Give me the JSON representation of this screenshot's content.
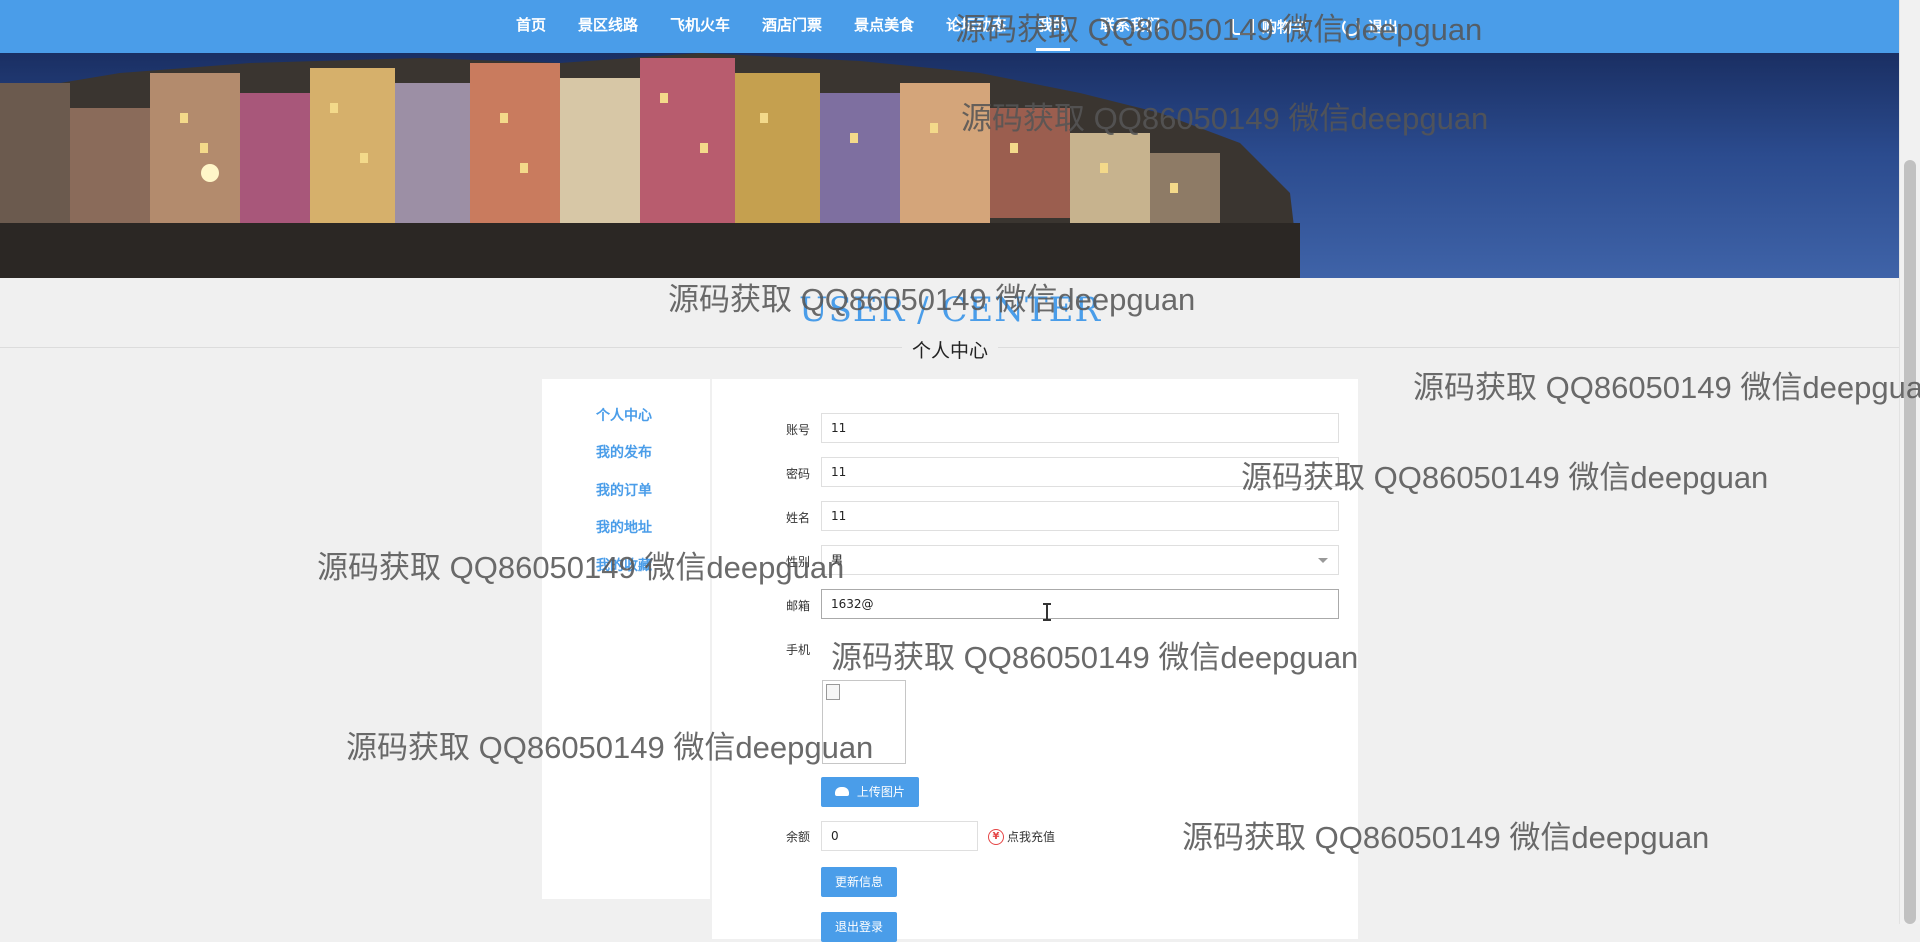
{
  "nav": {
    "items": [
      "首页",
      "景区线路",
      "飞机火车",
      "酒店门票",
      "景点美食",
      "论坛动态",
      "我的",
      "联系我们"
    ],
    "active_index": 6,
    "cart_label": "购物车",
    "logout_label": "退出"
  },
  "heading": {
    "en": "USER / CENTER",
    "cn": "个人中心"
  },
  "side_menu": [
    "个人中心",
    "我的发布",
    "我的订单",
    "我的地址",
    "我的收藏"
  ],
  "form": {
    "account_label": "账号",
    "account_value": "11",
    "password_label": "密码",
    "password_value": "11",
    "name_label": "姓名",
    "name_value": "11",
    "gender_label": "性别",
    "gender_value": "男",
    "email_label": "邮箱",
    "email_value": "1632@",
    "phone_label": "手机",
    "phone_value": "",
    "upload_label": "上传图片",
    "balance_label": "余额",
    "balance_value": "0",
    "recharge_label": "点我充值",
    "update_label": "更新信息",
    "logout_label": "退出登录"
  },
  "watermark": "源码获取 QQ86050149 微信deepguan",
  "colors": {
    "accent": "#4a9de9",
    "page_bg": "#f0f0f0",
    "recharge_icon": "#e54646"
  }
}
